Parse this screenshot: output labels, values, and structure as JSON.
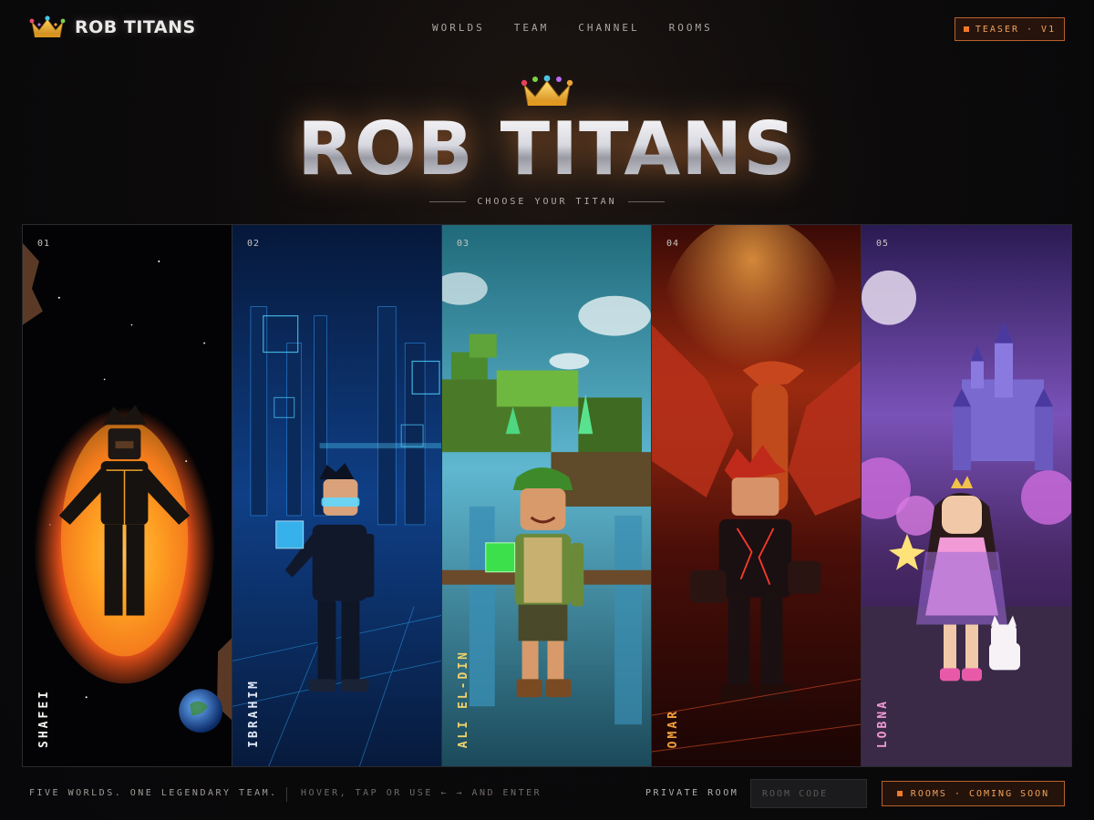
{
  "brand": {
    "name": "ROB TITANS"
  },
  "nav": {
    "items": [
      "WORLDS",
      "TEAM",
      "CHANNEL",
      "ROOMS"
    ]
  },
  "teaser_badge": "TEASER · V1",
  "hero": {
    "title": "ROB TITANS",
    "subtitle": "CHOOSE YOUR TITAN"
  },
  "panels": [
    {
      "number": "01",
      "name": "SHAFEI",
      "name_color": "#f4f2ee"
    },
    {
      "number": "02",
      "name": "IBRAHIM",
      "name_color": "#dfe8f6"
    },
    {
      "number": "03",
      "name": "ALI EL-DIN",
      "name_color": "#f1d36a"
    },
    {
      "number": "04",
      "name": "OMAR",
      "name_color": "#f4a13c"
    },
    {
      "number": "05",
      "name": "LOBNA",
      "name_color": "#f29ad6"
    }
  ],
  "footer": {
    "tagline": "FIVE WORLDS. ONE LEGENDARY TEAM.",
    "hint": "HOVER, TAP OR USE ← → AND ENTER",
    "private_label": "PRIVATE ROOM",
    "room_placeholder": "ROOM CODE",
    "rooms_button": "ROOMS · COMING SOON"
  },
  "colors": {
    "accent": "#f07a2a",
    "accent_text": "#f2a25a",
    "background": "#0c0a0b"
  },
  "icons": {
    "brand": "crown-icon",
    "hero": "crown-icon"
  }
}
